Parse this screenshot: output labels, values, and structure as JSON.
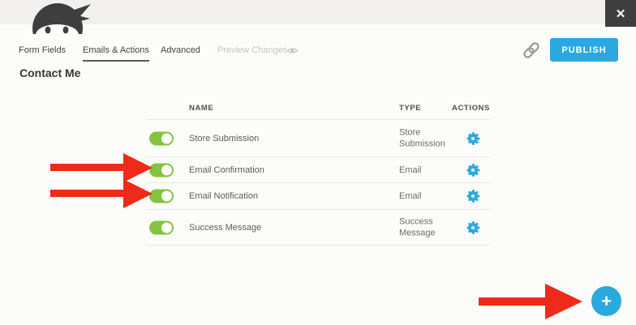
{
  "header": {
    "close_glyph": "✕",
    "tabs": [
      {
        "label": "Form Fields",
        "state": "normal"
      },
      {
        "label": "Emails & Actions",
        "state": "active"
      },
      {
        "label": "Advanced",
        "state": "normal"
      },
      {
        "label": "Preview Changes",
        "state": "disabled"
      }
    ],
    "form_title": "Contact Me",
    "publish_label": "PUBLISH"
  },
  "table": {
    "headers": {
      "name": "NAME",
      "type": "TYPE",
      "actions": "ACTIONS"
    },
    "rows": [
      {
        "name": "Store Submission",
        "type": "Store Submission",
        "enabled": true
      },
      {
        "name": "Email Confirmation",
        "type": "Email",
        "enabled": true
      },
      {
        "name": "Email Notification",
        "type": "Email",
        "enabled": true
      },
      {
        "name": "Success Message",
        "type": "Success Message",
        "enabled": true
      }
    ]
  },
  "fab": {
    "plus_glyph": "+"
  },
  "annotations": {
    "arrow_count": 3
  },
  "colors": {
    "accent_blue": "#2aa9e0",
    "toggle_green": "#84c340",
    "arrow_red": "#ee2a1a",
    "topbar_gray": "#f1f0ee",
    "close_dark": "#3e3e3e"
  }
}
